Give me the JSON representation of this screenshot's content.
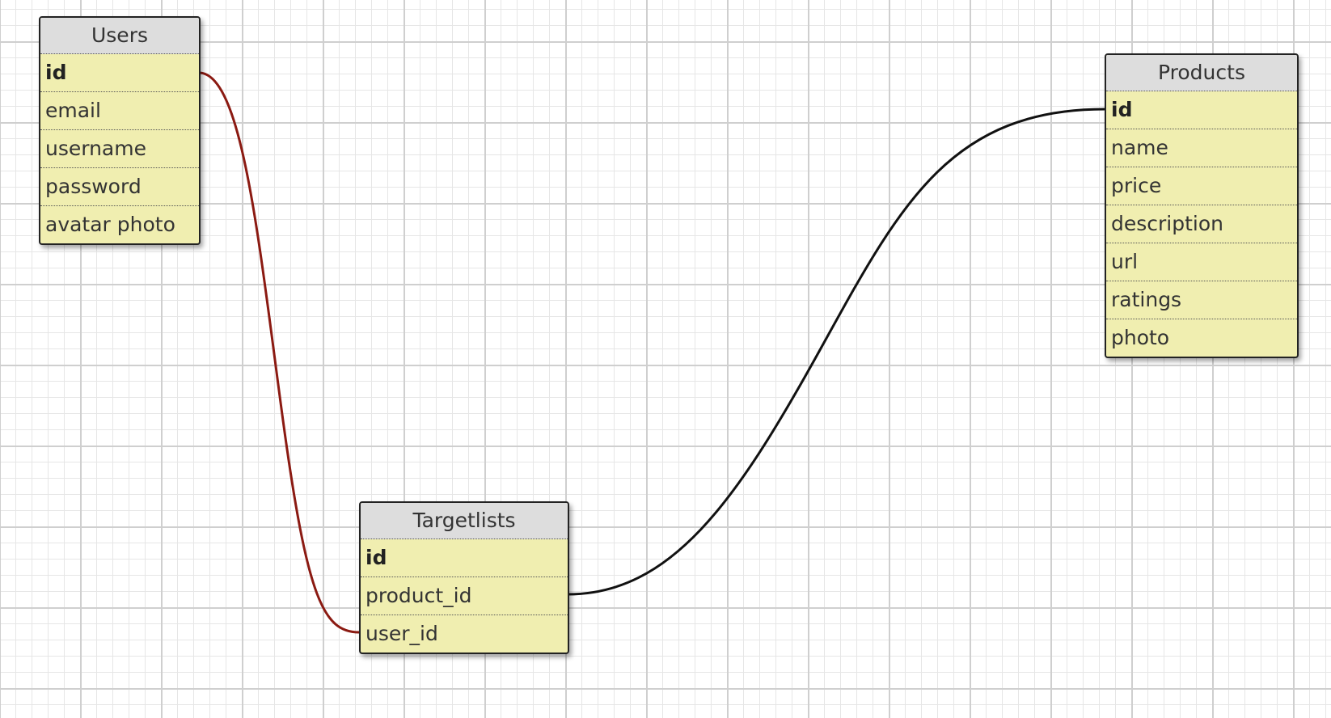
{
  "tables": {
    "users": {
      "title": "Users",
      "fields": [
        "id",
        "email",
        "username",
        "password",
        "avatar photo"
      ]
    },
    "products": {
      "title": "Products",
      "fields": [
        "id",
        "name",
        "price",
        "description",
        "url",
        "ratings",
        "photo"
      ]
    },
    "targetlists": {
      "title": "Targetlists",
      "fields": [
        "id",
        "product_id",
        "user_id"
      ]
    }
  },
  "relations": [
    {
      "from": "users.id",
      "to": "targetlists.user_id",
      "color": "#8b1a12"
    },
    {
      "from": "products.id",
      "to": "targetlists.product_id",
      "color": "#111111"
    }
  ]
}
